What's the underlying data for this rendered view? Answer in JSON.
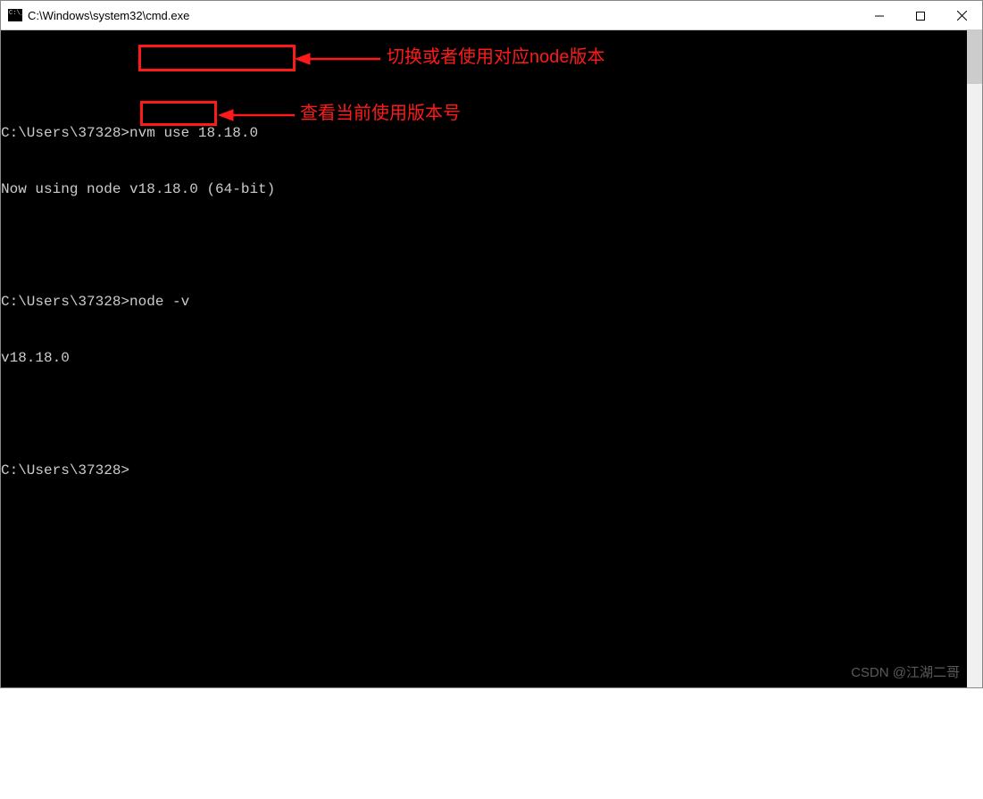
{
  "titlebar": {
    "title": "C:\\Windows\\system32\\cmd.exe"
  },
  "terminal": {
    "prompt1": "C:\\Users\\37328>",
    "cmd1": "nvm use 18.18.0",
    "output1": "Now using node v18.18.0 (64-bit)",
    "prompt2": "C:\\Users\\37328>",
    "cmd2": "node -v",
    "output2": "v18.18.0",
    "prompt3": "C:\\Users\\37328>"
  },
  "annotations": {
    "label1": "切换或者使用对应node版本",
    "label2": "查看当前使用版本号"
  },
  "watermark": "CSDN @江湖二哥"
}
